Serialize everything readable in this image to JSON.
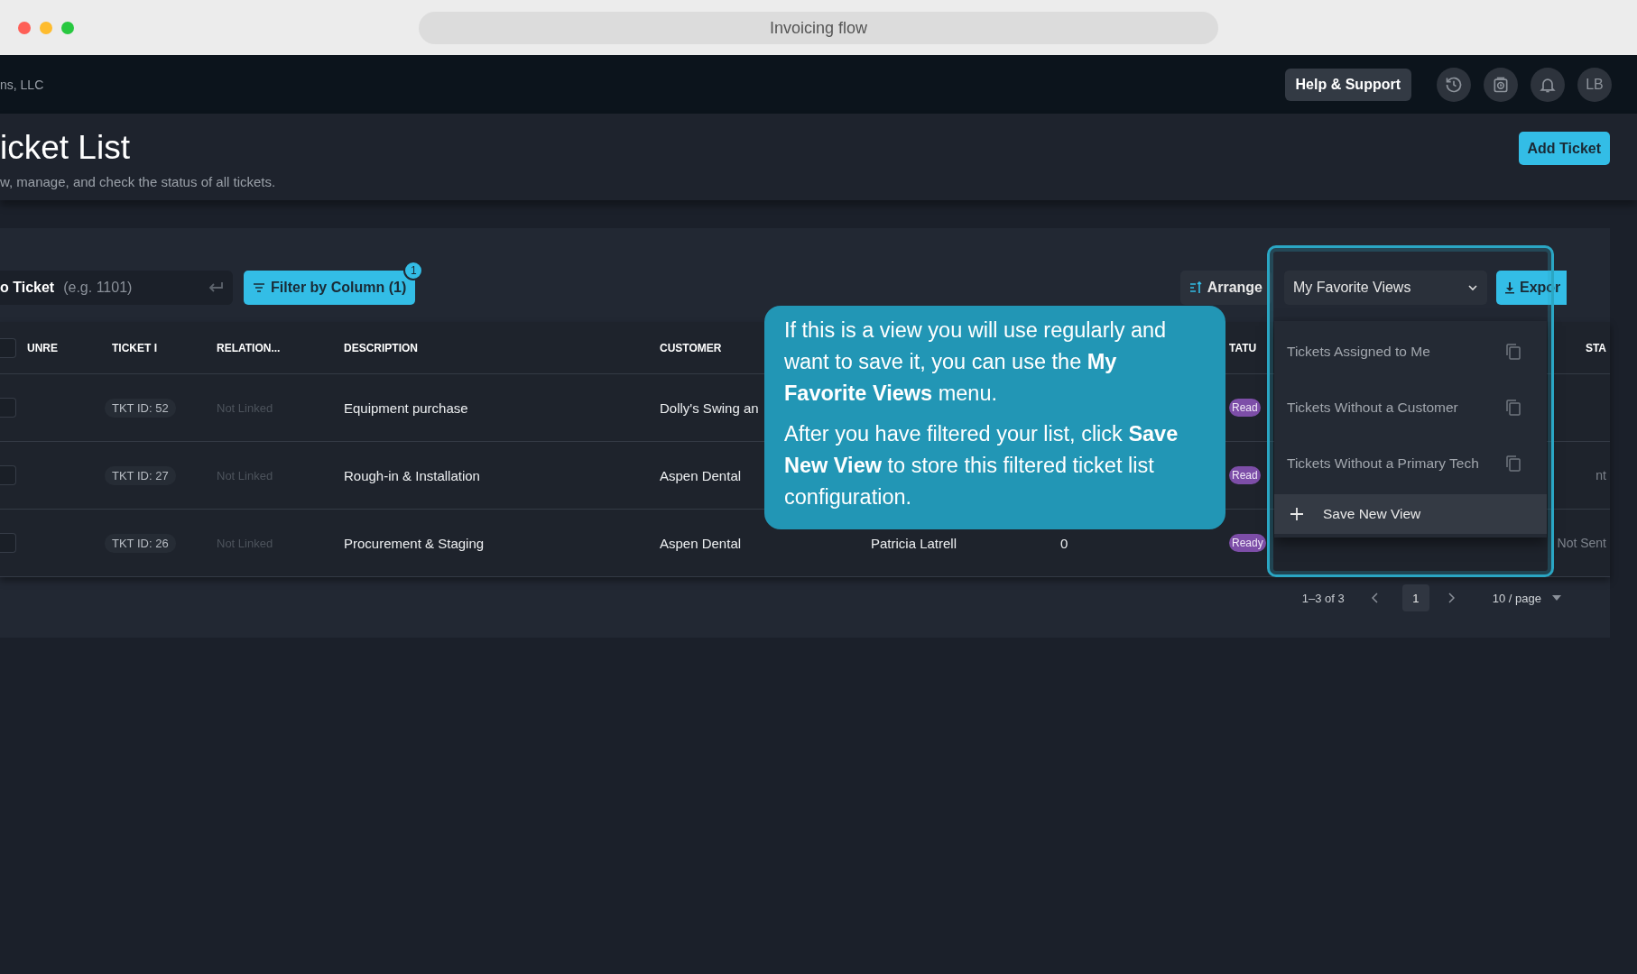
{
  "browser": {
    "title": "Invoicing flow"
  },
  "top_bar": {
    "company": "ns, LLC",
    "help_button": "Help & Support",
    "avatar": "LB"
  },
  "header": {
    "title": "icket List",
    "subtitle": "w, manage, and check the status of all tickets.",
    "add_button": "Add Ticket"
  },
  "toolbar": {
    "search_label": "o Ticket",
    "search_placeholder": "(e.g. 1101)",
    "filter_button": "Filter by Column (1)",
    "filter_badge": "1",
    "arrange_button": "Arrange",
    "views_dropdown": "My Favorite Views",
    "export_button": "Expor"
  },
  "table": {
    "header_checked": false,
    "columns": [
      {
        "label": "UNRE"
      },
      {
        "label": "TICKET I"
      },
      {
        "label": "RELATION..."
      },
      {
        "label": "DESCRIPTION"
      },
      {
        "label": "CUSTOMER"
      },
      {},
      {},
      {
        "label": "TATU"
      },
      {},
      {
        "label": "STA"
      }
    ],
    "rows": [
      {
        "checked": false,
        "ticket": "TKT ID: 52",
        "relation": "Not Linked",
        "description": "Equipment purchase",
        "customer": "Dolly's Swing an",
        "status": "Read"
      },
      {
        "checked": false,
        "ticket": "TKT ID: 27",
        "relation": "Not Linked",
        "description": "Rough-in & Installation",
        "customer": "Aspen Dental",
        "status": "Read",
        "column_11": "nt"
      },
      {
        "checked": false,
        "ticket": "TKT ID: 26",
        "relation": "Not Linked",
        "description": "Procurement & Staging",
        "customer": "Aspen Dental",
        "column_7": "Patricia Latrell",
        "column_8": "0",
        "status": "Ready",
        "column_11": "Not Sent"
      }
    ]
  },
  "pagination": {
    "range": "1–3 of 3",
    "pages": [
      {
        "label": "1",
        "selected": true
      }
    ],
    "page_size": "10 / page"
  },
  "views_menu": {
    "items": [
      {
        "label": "Tickets Assigned to Me"
      },
      {
        "label": "Tickets Without a Customer"
      },
      {
        "label": "Tickets Without a Primary Tech"
      }
    ],
    "save_item": "Save New View"
  },
  "tooltip": {
    "paragraphs": [
      "If this is a view you will use regularly and want to save it, you can use the **My Favorite Views** menu.",
      "After you have filtered your list, click **Save New View** to store this filtered ticket list configuration."
    ]
  }
}
